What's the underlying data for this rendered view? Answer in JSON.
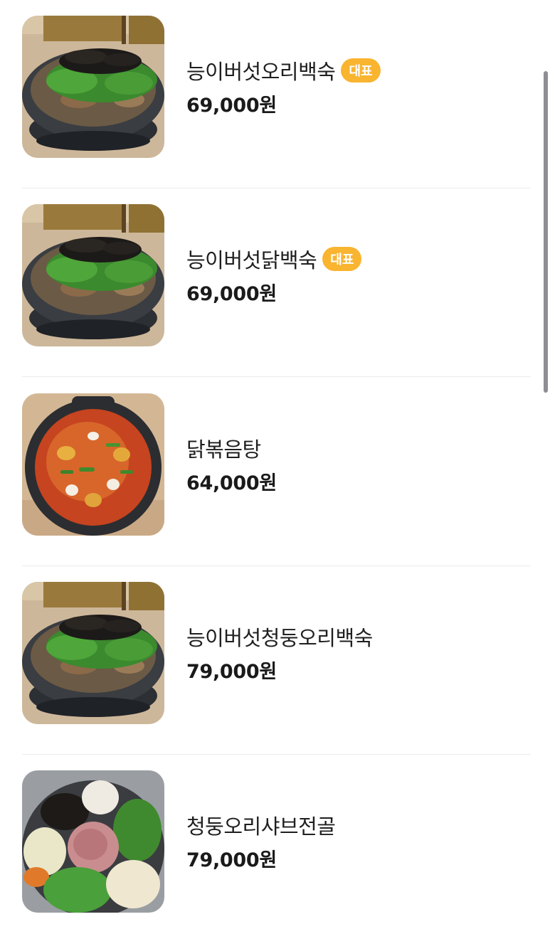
{
  "menu": {
    "items": [
      {
        "name": "능이버섯오리백숙",
        "badge": "대표",
        "price": "69,000원",
        "image": "mushroom-duck-stew-photo"
      },
      {
        "name": "능이버섯닭백숙",
        "badge": "대표",
        "price": "69,000원",
        "image": "mushroom-chicken-stew-photo"
      },
      {
        "name": "닭볶음탕",
        "badge": null,
        "price": "64,000원",
        "image": "spicy-braised-chicken-photo"
      },
      {
        "name": "능이버섯청둥오리백숙",
        "badge": null,
        "price": "79,000원",
        "image": "mushroom-wild-duck-stew-photo"
      },
      {
        "name": "청둥오리샤브전골",
        "badge": null,
        "price": "79,000원",
        "image": "wild-duck-shabu-hotpot-photo"
      }
    ]
  },
  "colors": {
    "badge_background": "#f9b430",
    "badge_text": "#ffffff",
    "divider": "#ececec",
    "scrollbar": "#8e8e93"
  }
}
